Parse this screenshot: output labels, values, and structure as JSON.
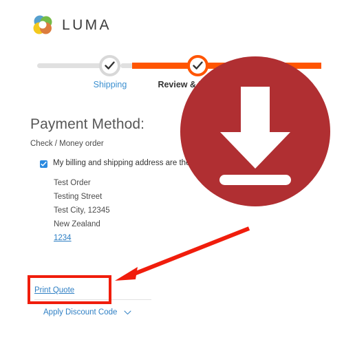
{
  "brand": {
    "name": "LUMA",
    "logo_icon": "luma-circles-logo",
    "logo_colors": [
      "#4a90c4",
      "#63b22f",
      "#f4c300",
      "#c8662a"
    ]
  },
  "checkout_progress": {
    "steps": [
      {
        "label": "Shipping",
        "state": "complete",
        "icon": "check-icon"
      },
      {
        "label": "Review & Payments",
        "state": "active",
        "icon": "check-icon"
      }
    ],
    "active_color": "#ff5501",
    "inactive_color": "#e0e0e0",
    "completed_label_color": "#3a8fd0"
  },
  "main": {
    "heading": "Payment Method:",
    "payment_type": "Check / Money order",
    "billing_checkbox": {
      "label": "My billing and shipping address are the same",
      "checked": true,
      "checkbox_color": "#2a8ae0"
    },
    "address": {
      "lines": [
        "Test Order",
        "Testing Street",
        "Test City, 12345",
        "New Zealand"
      ],
      "phone": "1234",
      "phone_color": "#2e7fc4"
    }
  },
  "footer": {
    "print_quote_label": "Print Quote",
    "apply_discount_label": "Apply Discount Code",
    "chevron_icon": "chevron-down-icon",
    "link_color": "#2e7fc4"
  },
  "annotations": {
    "badge": {
      "icon": "download-icon",
      "circle_color": "#b02f32",
      "glyph_color": "#ffffff"
    },
    "arrow": {
      "icon": "arrow-down-left-icon",
      "color": "#f01d0c"
    },
    "highlight_box": {
      "target": "Print Quote",
      "color": "#f01d0c"
    }
  }
}
